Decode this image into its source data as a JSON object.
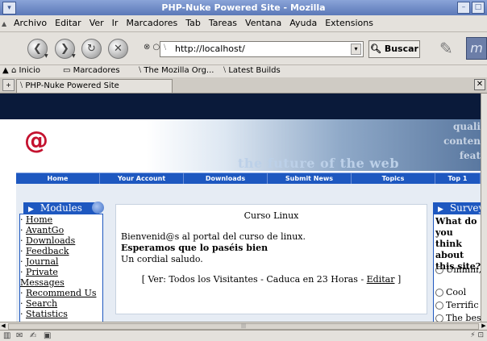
{
  "window": {
    "title": "PHP-Nuke Powered Site - Mozilla"
  },
  "menubar": {
    "items": [
      "Archivo",
      "Editar",
      "Ver",
      "Ir",
      "Marcadores",
      "Tab",
      "Tareas",
      "Ventana",
      "Ayuda",
      "Extensions"
    ]
  },
  "navigation": {
    "url": "http://localhost/",
    "search_label": "Buscar"
  },
  "bookmarks": {
    "items": [
      "Inicio",
      "Marcadores",
      "The Mozilla Org...",
      "Latest Builds"
    ]
  },
  "tabs": {
    "active_title": "PHP-Nuke Powered Site"
  },
  "page": {
    "banner_text": "the future of the web",
    "banner_side": [
      "quali",
      "conten",
      "feat"
    ],
    "nav_links": [
      "Home",
      "Your Account",
      "Downloads",
      "Submit News",
      "Topics",
      "Top 1"
    ],
    "modules_title": "Modules",
    "modules": [
      "Home",
      "AvantGo",
      "Downloads",
      "Feedback",
      "Journal",
      "Private Messages",
      "Recommend Us",
      "Search",
      "Statistics"
    ],
    "center_title": "Curso Linux",
    "center_line1": "Bienvenid@s al portal del curso de linux.",
    "center_line2": "Esperamos que lo paséis bien",
    "center_line3": "Un cordial saludo.",
    "center_footer_pre": "[ Ver: Todos los Visitantes - Caduca en 23 Horas - ",
    "center_footer_link": "Editar",
    "center_footer_post": " ]",
    "survey_title": "Survey",
    "survey_question": "What do you think about this site?",
    "survey_options": [
      "Ummm, not bad",
      "Cool",
      "Terrific",
      "The best"
    ]
  },
  "colors": {
    "nav_blue": "#1e58c0",
    "dark_band": "#0a1a3a",
    "light_band": "#e6ecf4",
    "logo_red": "#c4122f"
  }
}
